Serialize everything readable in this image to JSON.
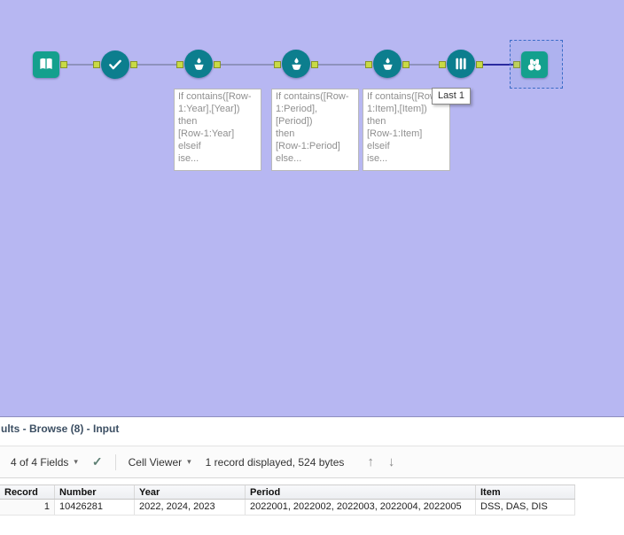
{
  "colors": {
    "canvas_bg": "#b7b7f2",
    "tool_square": "#14a08d",
    "tool_circle": "#0c7e8e",
    "anchor": "#c9da45",
    "connection": "#8e92bd",
    "connection_selected": "#2b2ba0",
    "selection_border": "#3b6cc7"
  },
  "icons": {
    "chevron_down": "▾",
    "check": "✓",
    "arrow_up": "↑",
    "arrow_down": "↓"
  },
  "canvas": {
    "tools": [
      {
        "id": "input-data",
        "icon": "book-icon",
        "shape": "square"
      },
      {
        "id": "select",
        "icon": "check-icon",
        "shape": "circle"
      },
      {
        "id": "multi-row-formula-1",
        "icon": "formula-drop-icon",
        "shape": "circle"
      },
      {
        "id": "multi-row-formula-2",
        "icon": "formula-drop-icon",
        "shape": "circle"
      },
      {
        "id": "multi-row-formula-3",
        "icon": "formula-drop-icon",
        "shape": "circle"
      },
      {
        "id": "sample",
        "icon": "test-tubes-icon",
        "shape": "circle"
      },
      {
        "id": "browse",
        "icon": "binoculars-icon",
        "shape": "square",
        "selected": true
      }
    ],
    "annotations": [
      {
        "text": "If contains([Row-\n1:Year],[Year])\nthen\n[Row-1:Year]\nelseif\nise..."
      },
      {
        "text": "If contains([Row-\n1:Period],\n[Period])\nthen\n[Row-1:Period]\nelse..."
      },
      {
        "text": "If contains([Row-\n1:Item],[Item])\nthen\n[Row-1:Item]\nelseif\nise..."
      }
    ],
    "sample_annotation": "Last 1"
  },
  "results": {
    "header_title": "ults - Browse (8) - Input",
    "toolbar": {
      "fields_dropdown_label": "4 of 4 Fields",
      "cell_viewer_label": "Cell Viewer",
      "status_text": "1 record displayed, 524 bytes"
    },
    "table": {
      "columns": [
        "Record",
        "Number",
        "Year",
        "Period",
        "Item"
      ],
      "rows": [
        {
          "record": "1",
          "number": "10426281",
          "year": "2022, 2024, 2023",
          "period": "2022001, 2022002, 2022003, 2022004, 2022005",
          "item": "DSS, DAS, DIS"
        }
      ]
    }
  }
}
